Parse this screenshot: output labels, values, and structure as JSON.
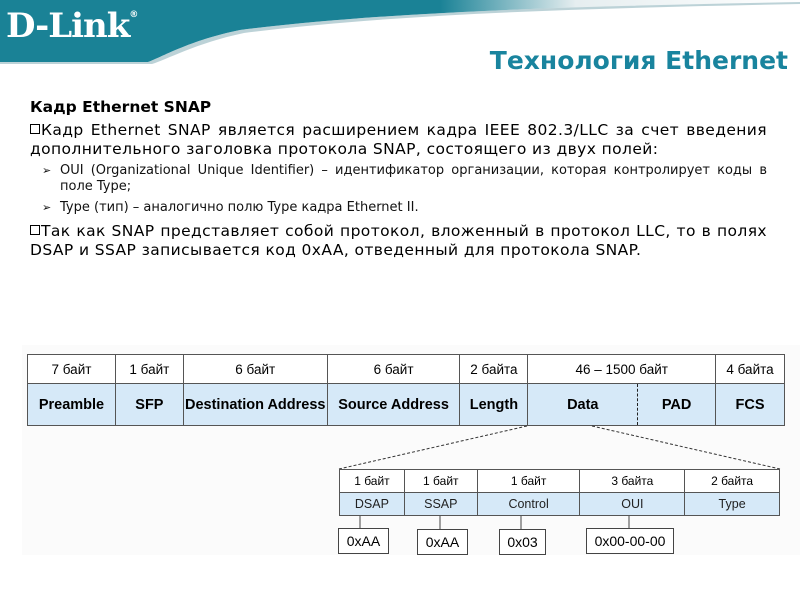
{
  "header": {
    "logo_text": "D-Link",
    "logo_mark": "®",
    "title": "Технология Ethernet",
    "brand_color": "#1a8296",
    "title_color": "#19849e"
  },
  "content": {
    "heading": "Кадр Ethernet SNAP",
    "para1": "Кадр Ethernet SNAP является расширением кадра IEEE 802.3/LLC за счет введения дополнительного заголовка протокола SNAP, состоящего из двух полей:",
    "bullets": [
      {
        "text": "OUI (Organizational Unique Identifier) – идентификатор организации, которая контролирует коды в поле Type;"
      },
      {
        "text": "Type (тип) – аналогично полю Type кадра Ethernet II."
      }
    ],
    "para2": "Так как SNAP представляет собой протокол, вложенный в протокол LLC, то в полях DSAP и SSAP записывается код 0xAA, отведенный для протокола SNAP.",
    "bullet_icon": "square-bullet-icon",
    "sub_bullet_icon": "arrow-bullet-icon",
    "arrow_glyph": "➢"
  },
  "frame": {
    "sizes": [
      "7 байт",
      "1 байт",
      "6 байт",
      "6 байт",
      "2 байта",
      "46 – 1500 байт",
      "4 байта"
    ],
    "fields": [
      "Preamble",
      "SFP",
      "Destination Address",
      "Source Address",
      "Length",
      "Data",
      "PAD",
      "FCS"
    ],
    "field_color": "#d6e9f8"
  },
  "snap": {
    "sizes": [
      "1 байт",
      "1 байт",
      "1 байт",
      "3 байта",
      "2 байта"
    ],
    "fields": [
      "DSAP",
      "SSAP",
      "Control",
      "OUI",
      "Type"
    ],
    "values": [
      "0xAA",
      "0xAA",
      "0x03",
      "0x00-00-00"
    ]
  }
}
